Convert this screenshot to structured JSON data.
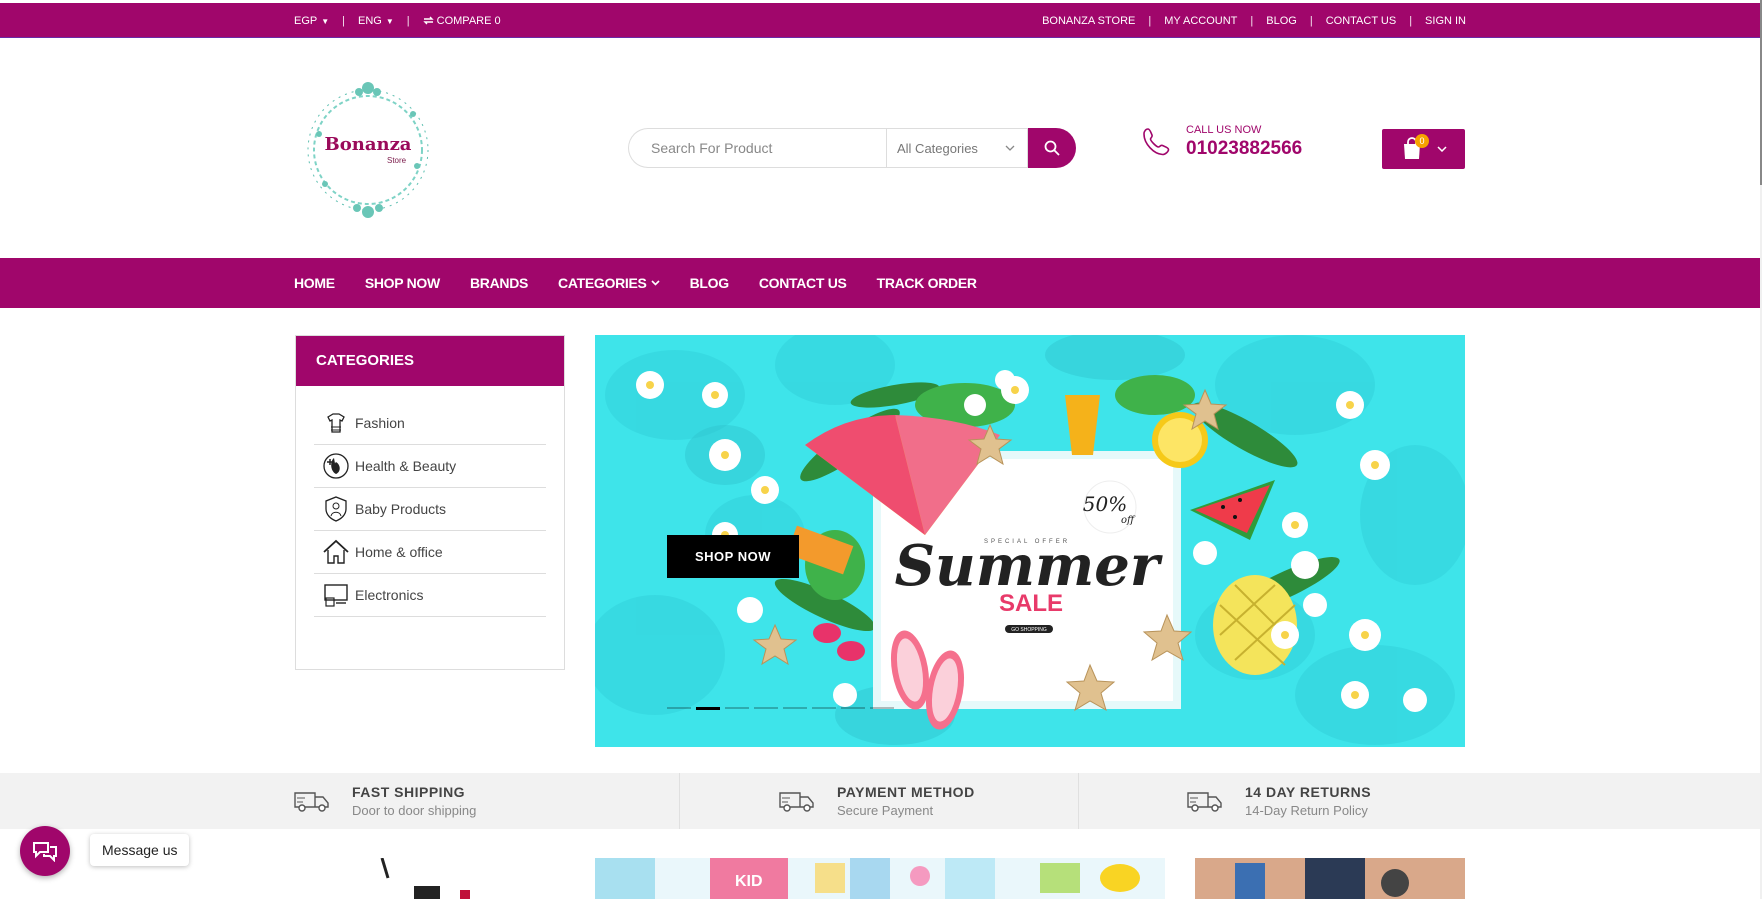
{
  "topbar": {
    "currency": "EGP",
    "language": "ENG",
    "compare_label": "COMPARE 0",
    "right_links": [
      "BONANZA STORE",
      "MY ACCOUNT",
      "BLOG",
      "CONTACT US",
      "SIGN IN"
    ]
  },
  "logo": {
    "name": "Bonanza",
    "sub": "Store"
  },
  "search": {
    "placeholder": "Search For Product",
    "category": "All Categories"
  },
  "callus": {
    "label": "CALL US NOW",
    "number": "01023882566"
  },
  "cart": {
    "count": "0"
  },
  "nav": {
    "items": [
      "HOME",
      "SHOP NOW",
      "BRANDS",
      "CATEGORIES",
      "BLOG",
      "CONTACT US",
      "TRACK ORDER"
    ]
  },
  "categories": {
    "title": "CATEGORIES",
    "items": [
      {
        "label": "Fashion",
        "icon": "fashion-icon"
      },
      {
        "label": "Health & Beauty",
        "icon": "health-beauty-icon"
      },
      {
        "label": "Baby Products",
        "icon": "baby-products-icon"
      },
      {
        "label": "Home & office",
        "icon": "home-office-icon"
      },
      {
        "label": "Electronics",
        "icon": "electronics-icon"
      }
    ]
  },
  "banner": {
    "shop_now": "SHOP NOW",
    "art_special": "SPECIAL OFFER",
    "art_summer": "Summer",
    "art_sale": "SALE",
    "art_discount": "50%",
    "art_off": "off",
    "art_go": "GO SHOPPING",
    "slides": 8,
    "active_slide": 2
  },
  "features": [
    {
      "title": "FAST SHIPPING",
      "subtitle": "Door to door shipping"
    },
    {
      "title": "PAYMENT METHOD",
      "subtitle": "Secure Payment"
    },
    {
      "title": "14 DAY RETURNS",
      "subtitle": "14-Day Return Policy"
    }
  ],
  "chat": {
    "label": "Message us"
  },
  "promo": {
    "kid_tag": "KID"
  },
  "colors": {
    "brand": "#a0066b",
    "accent": "#f7a200",
    "banner_bg": "#3ee0e6"
  }
}
